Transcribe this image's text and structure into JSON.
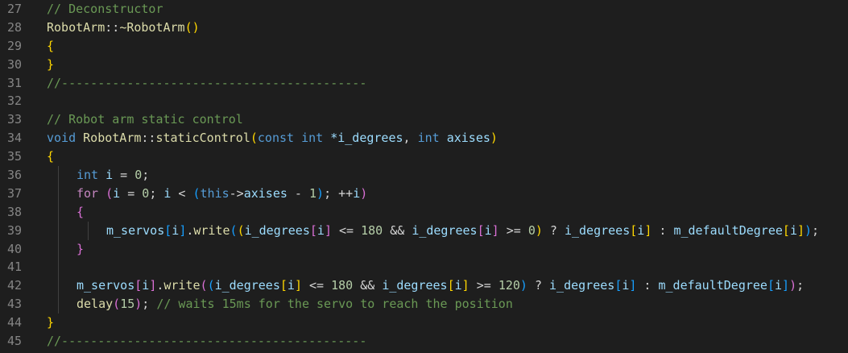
{
  "lines": [
    {
      "n": "27",
      "indent": 0,
      "tokens": [
        [
          "// Deconstructor",
          "comment"
        ]
      ]
    },
    {
      "n": "28",
      "indent": 0,
      "tokens": [
        [
          "RobotArm",
          "type"
        ],
        [
          "::",
          "plain"
        ],
        [
          "~RobotArm",
          "type"
        ],
        [
          "()",
          "b1"
        ]
      ]
    },
    {
      "n": "29",
      "indent": 0,
      "tokens": [
        [
          "{",
          "b1"
        ]
      ]
    },
    {
      "n": "30",
      "indent": 0,
      "tokens": [
        [
          "}",
          "b1"
        ]
      ]
    },
    {
      "n": "31",
      "indent": 0,
      "tokens": [
        [
          "//------------------------------------------",
          "comment"
        ]
      ]
    },
    {
      "n": "32",
      "indent": 0,
      "tokens": []
    },
    {
      "n": "33",
      "indent": 0,
      "tokens": [
        [
          "// Robot arm static control",
          "comment"
        ]
      ]
    },
    {
      "n": "34",
      "indent": 0,
      "tokens": [
        [
          "void",
          "kw"
        ],
        [
          " ",
          "plain"
        ],
        [
          "RobotArm",
          "type"
        ],
        [
          "::",
          "plain"
        ],
        [
          "staticControl",
          "type"
        ],
        [
          "(",
          "b1"
        ],
        [
          "const",
          "kw"
        ],
        [
          " ",
          "plain"
        ],
        [
          "int",
          "kw"
        ],
        [
          " ",
          "plain"
        ],
        [
          "*i_degrees",
          "var"
        ],
        [
          ", ",
          "plain"
        ],
        [
          "int",
          "kw"
        ],
        [
          " ",
          "plain"
        ],
        [
          "axises",
          "var"
        ],
        [
          ")",
          "b1"
        ]
      ]
    },
    {
      "n": "35",
      "indent": 0,
      "tokens": [
        [
          "{",
          "b1"
        ]
      ]
    },
    {
      "n": "36",
      "indent": 1,
      "tokens": [
        [
          "int",
          "kw"
        ],
        [
          " ",
          "plain"
        ],
        [
          "i",
          "var"
        ],
        [
          " = ",
          "plain"
        ],
        [
          "0",
          "num"
        ],
        [
          ";",
          "plain"
        ]
      ]
    },
    {
      "n": "37",
      "indent": 1,
      "tokens": [
        [
          "for",
          "ctrl"
        ],
        [
          " ",
          "plain"
        ],
        [
          "(",
          "b2"
        ],
        [
          "i",
          "var"
        ],
        [
          " = ",
          "plain"
        ],
        [
          "0",
          "num"
        ],
        [
          "; ",
          "plain"
        ],
        [
          "i",
          "var"
        ],
        [
          " < ",
          "plain"
        ],
        [
          "(",
          "b3"
        ],
        [
          "this",
          "kw"
        ],
        [
          "->",
          "plain"
        ],
        [
          "axises",
          "var"
        ],
        [
          " - ",
          "plain"
        ],
        [
          "1",
          "num"
        ],
        [
          ")",
          "b3"
        ],
        [
          "; ++",
          "plain"
        ],
        [
          "i",
          "var"
        ],
        [
          ")",
          "b2"
        ]
      ]
    },
    {
      "n": "38",
      "indent": 1,
      "tokens": [
        [
          "{",
          "b2"
        ]
      ]
    },
    {
      "n": "39",
      "indent": 2,
      "tokens": [
        [
          "m_servos",
          "var"
        ],
        [
          "[",
          "b3"
        ],
        [
          "i",
          "var"
        ],
        [
          "]",
          "b3"
        ],
        [
          ".",
          "plain"
        ],
        [
          "write",
          "type"
        ],
        [
          "(",
          "b3"
        ],
        [
          "(",
          "b1"
        ],
        [
          "i_degrees",
          "var"
        ],
        [
          "[",
          "b2"
        ],
        [
          "i",
          "var"
        ],
        [
          "]",
          "b2"
        ],
        [
          " <= ",
          "plain"
        ],
        [
          "180",
          "num"
        ],
        [
          " && ",
          "plain"
        ],
        [
          "i_degrees",
          "var"
        ],
        [
          "[",
          "b2"
        ],
        [
          "i",
          "var"
        ],
        [
          "]",
          "b2"
        ],
        [
          " >= ",
          "plain"
        ],
        [
          "0",
          "num"
        ],
        [
          ")",
          "b1"
        ],
        [
          " ? ",
          "plain"
        ],
        [
          "i_degrees",
          "var"
        ],
        [
          "[",
          "b1"
        ],
        [
          "i",
          "var"
        ],
        [
          "]",
          "b1"
        ],
        [
          " : ",
          "plain"
        ],
        [
          "m_defaultDegree",
          "var"
        ],
        [
          "[",
          "b1"
        ],
        [
          "i",
          "var"
        ],
        [
          "]",
          "b1"
        ],
        [
          ")",
          "b3"
        ],
        [
          ";",
          "plain"
        ]
      ]
    },
    {
      "n": "40",
      "indent": 1,
      "tokens": [
        [
          "}",
          "b2"
        ]
      ]
    },
    {
      "n": "41",
      "indent": 1,
      "tokens": []
    },
    {
      "n": "42",
      "indent": 1,
      "tokens": [
        [
          "m_servos",
          "var"
        ],
        [
          "[",
          "b2"
        ],
        [
          "i",
          "var"
        ],
        [
          "]",
          "b2"
        ],
        [
          ".",
          "plain"
        ],
        [
          "write",
          "type"
        ],
        [
          "(",
          "b2"
        ],
        [
          "(",
          "b3"
        ],
        [
          "i_degrees",
          "var"
        ],
        [
          "[",
          "b1"
        ],
        [
          "i",
          "var"
        ],
        [
          "]",
          "b1"
        ],
        [
          " <= ",
          "plain"
        ],
        [
          "180",
          "num"
        ],
        [
          " && ",
          "plain"
        ],
        [
          "i_degrees",
          "var"
        ],
        [
          "[",
          "b1"
        ],
        [
          "i",
          "var"
        ],
        [
          "]",
          "b1"
        ],
        [
          " >= ",
          "plain"
        ],
        [
          "120",
          "num"
        ],
        [
          ")",
          "b3"
        ],
        [
          " ? ",
          "plain"
        ],
        [
          "i_degrees",
          "var"
        ],
        [
          "[",
          "b3"
        ],
        [
          "i",
          "var"
        ],
        [
          "]",
          "b3"
        ],
        [
          " : ",
          "plain"
        ],
        [
          "m_defaultDegree",
          "var"
        ],
        [
          "[",
          "b3"
        ],
        [
          "i",
          "var"
        ],
        [
          "]",
          "b3"
        ],
        [
          ")",
          "b2"
        ],
        [
          ";",
          "plain"
        ]
      ]
    },
    {
      "n": "43",
      "indent": 1,
      "tokens": [
        [
          "delay",
          "type"
        ],
        [
          "(",
          "b2"
        ],
        [
          "15",
          "num"
        ],
        [
          ")",
          "b2"
        ],
        [
          "; ",
          "plain"
        ],
        [
          "// waits 15ms for the servo to reach the position",
          "comment"
        ]
      ]
    },
    {
      "n": "44",
      "indent": 0,
      "tokens": [
        [
          "}",
          "b1"
        ]
      ]
    },
    {
      "n": "45",
      "indent": 0,
      "tokens": [
        [
          "//------------------------------------------",
          "comment"
        ]
      ]
    }
  ]
}
